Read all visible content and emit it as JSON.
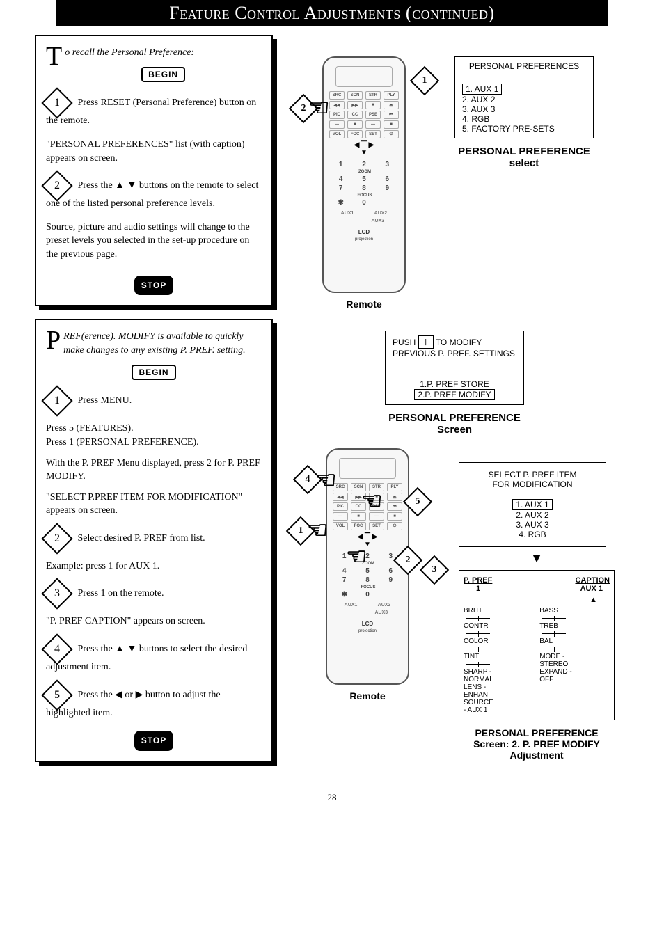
{
  "title": "Feature Control Adjustments (continued)",
  "page_number": "28",
  "procA": {
    "lead_first": "T",
    "lead_rest": "o recall the Personal Preference:",
    "begin": "BEGIN",
    "step1": "Press RESET (Personal Preference) button on the remote.",
    "step1_after": "\"PERSONAL PREFERENCES\" list (with caption) appears on screen.",
    "step2": "Press the ▲ ▼ buttons on the remote to select one of the listed personal preference levels.",
    "step2_after": "Source, picture and audio settings will change to the preset levels you selected in the set-up procedure on the previous page.",
    "stop": "STOP"
  },
  "procB": {
    "lead_first": "P",
    "lead_rest": "REF(erence). MODIFY is available to quickly make changes to any existing P. PREF. setting.",
    "begin": "BEGIN",
    "step1a": "Press MENU.",
    "step1b": "Press 5 (FEATURES).",
    "step1c": "Press 1 (PERSONAL PREFERENCE).",
    "step1_after": "With the P. PREF Menu displayed, press 2 for P. PREF MODIFY.",
    "step1_after2": "\"SELECT P.PREF ITEM FOR MODIFICATION\" appears on screen.",
    "step2": "Select desired P. PREF from list.",
    "step2_after": "Example: press 1 for AUX 1.",
    "step3": "Press 1 on the remote.",
    "step3_after": "\"P. PREF CAPTION\" appears on screen.",
    "step4": "Press the ▲ ▼ buttons to select the desired adjustment item.",
    "step5": "Press the ◀ or ▶ button to adjust the highlighted item.",
    "stop": "STOP"
  },
  "remote": {
    "caption": "Remote",
    "lcd": "LCD",
    "sub": "projection",
    "keys": [
      [
        "1",
        "2",
        "3"
      ],
      [
        "4",
        "5",
        "6"
      ],
      [
        "7",
        "8",
        "9"
      ],
      [
        "✱",
        "0",
        " "
      ]
    ],
    "top_rows": [
      [
        "SOURCE",
        "SCAN",
        "STORE",
        "PLAY"
      ],
      [
        "◀◀",
        "▶▶",
        "■",
        "⏏"
      ],
      [
        "PICTURE",
        "CC",
        "PAUSE",
        "⏮"
      ],
      [
        "—",
        "■",
        "—",
        "■"
      ],
      [
        "VOL",
        "FOCUS",
        "SET",
        " "
      ]
    ],
    "zoom": "ZOOM",
    "focus": "FOCUS",
    "bottom_labels": [
      "AUX1",
      "AUX2",
      "AUX3"
    ]
  },
  "screen1": {
    "header": "PERSONAL PREFERENCES",
    "items": [
      "1. AUX 1",
      "2. AUX 2",
      "3. AUX 3",
      "4. RGB",
      "5. FACTORY PRE-SETS"
    ],
    "caption_line1": "PERSONAL PREFERENCE",
    "caption_line2": "select"
  },
  "screen2": {
    "line1": "PUSH  ＋  TO MODIFY",
    "line2": "PREVIOUS P. PREF. SETTINGS",
    "opt1": "1.P. PREF STORE",
    "opt2": "2.P. PREF MODIFY",
    "caption_line1": "PERSONAL PREFERENCE",
    "caption_line2": "Screen"
  },
  "screen3": {
    "line1": "SELECT P. PREF ITEM",
    "line2": "FOR MODIFICATION",
    "items": [
      "1. AUX 1",
      "2. AUX 2",
      "3. AUX 3",
      "4. RGB"
    ]
  },
  "screen4": {
    "hdr_left": "P. PREF",
    "hdr_right": "CAPTION",
    "val_left": "1",
    "val_right": "AUX 1",
    "left_items": [
      "BRITE",
      "CONTR",
      "COLOR",
      "TINT",
      "SHARP - NORMAL",
      "LENS - ENHAN",
      "SOURCE - AUX 1"
    ],
    "right_items": [
      "BASS",
      "TREB",
      "BAL",
      "MODE - STEREO",
      "EXPAND - OFF"
    ],
    "caption_line1": "PERSONAL PREFERENCE",
    "caption_line2": "Screen: 2. P. PREF MODIFY",
    "caption_line3": "Adjustment"
  }
}
